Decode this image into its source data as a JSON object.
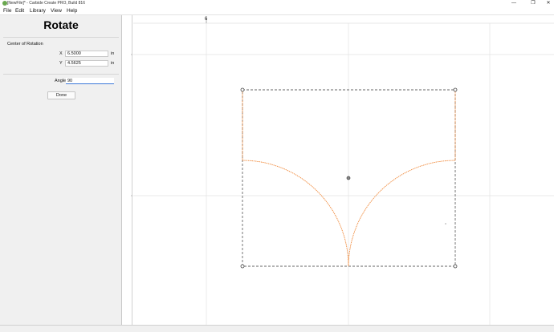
{
  "window": {
    "title": "[NewFile]* - Carbide Create PRO, Build 816",
    "minimize_glyph": "—",
    "maximize_glyph": "❐",
    "close_glyph": "✕"
  },
  "menu": {
    "items": [
      {
        "label": "File"
      },
      {
        "label": "Edit"
      },
      {
        "label": "Library"
      },
      {
        "label": "View"
      },
      {
        "label": "Help"
      }
    ]
  },
  "panel": {
    "title": "Rotate",
    "center_section_label": "Center of Rotation",
    "x_label": "X",
    "x_value": "6.5000",
    "x_unit": "in",
    "y_label": "Y",
    "y_value": "4.5625",
    "y_unit": "in",
    "angle_label": "Angle",
    "angle_value": "90",
    "done_label": "Done"
  },
  "canvas": {
    "ruler_label": "6",
    "colors": {
      "shape": "#f08a3c",
      "selection": "#666666",
      "grid": "#e3e3e3"
    }
  }
}
